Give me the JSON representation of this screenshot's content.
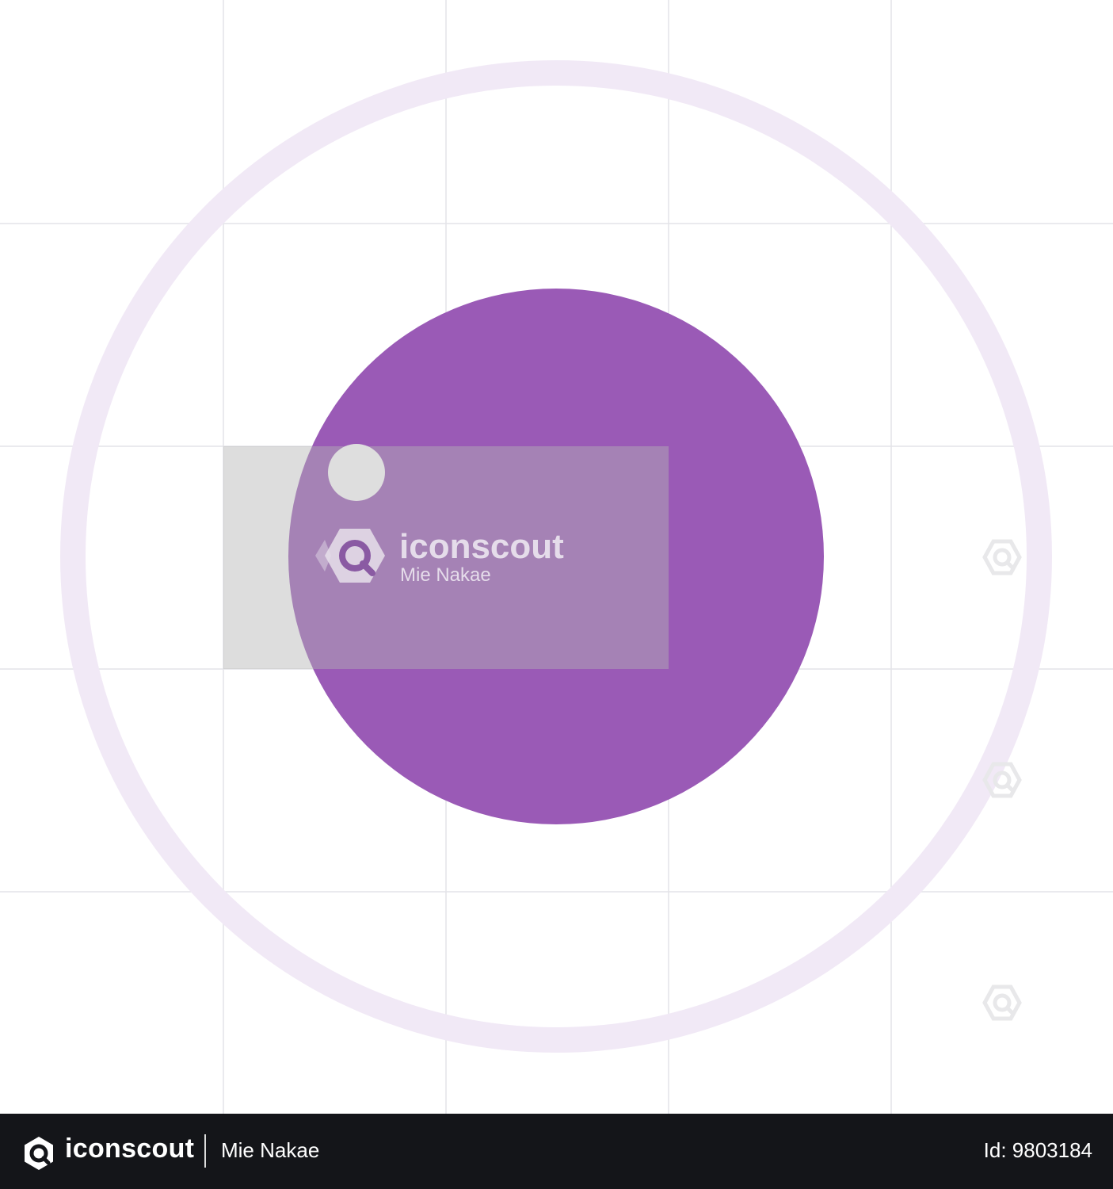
{
  "colors": {
    "background": "#ffffff",
    "grid": "#e3e3e8",
    "outer_ring": "#f1e9f6",
    "main_circle": "#9a5ab6",
    "overlay_box": "#dedede",
    "footer_bg": "#141519",
    "footer_text": "#ffffff"
  },
  "icons": [
    "iconscout-logo-icon",
    "watermark-hexagon-icon"
  ],
  "watermark": {
    "brand": "iconscout",
    "author": "Mie Nakae"
  },
  "footer": {
    "brand": "iconscout",
    "author": "Mie Nakae",
    "asset_id": "Id: 9803184"
  }
}
